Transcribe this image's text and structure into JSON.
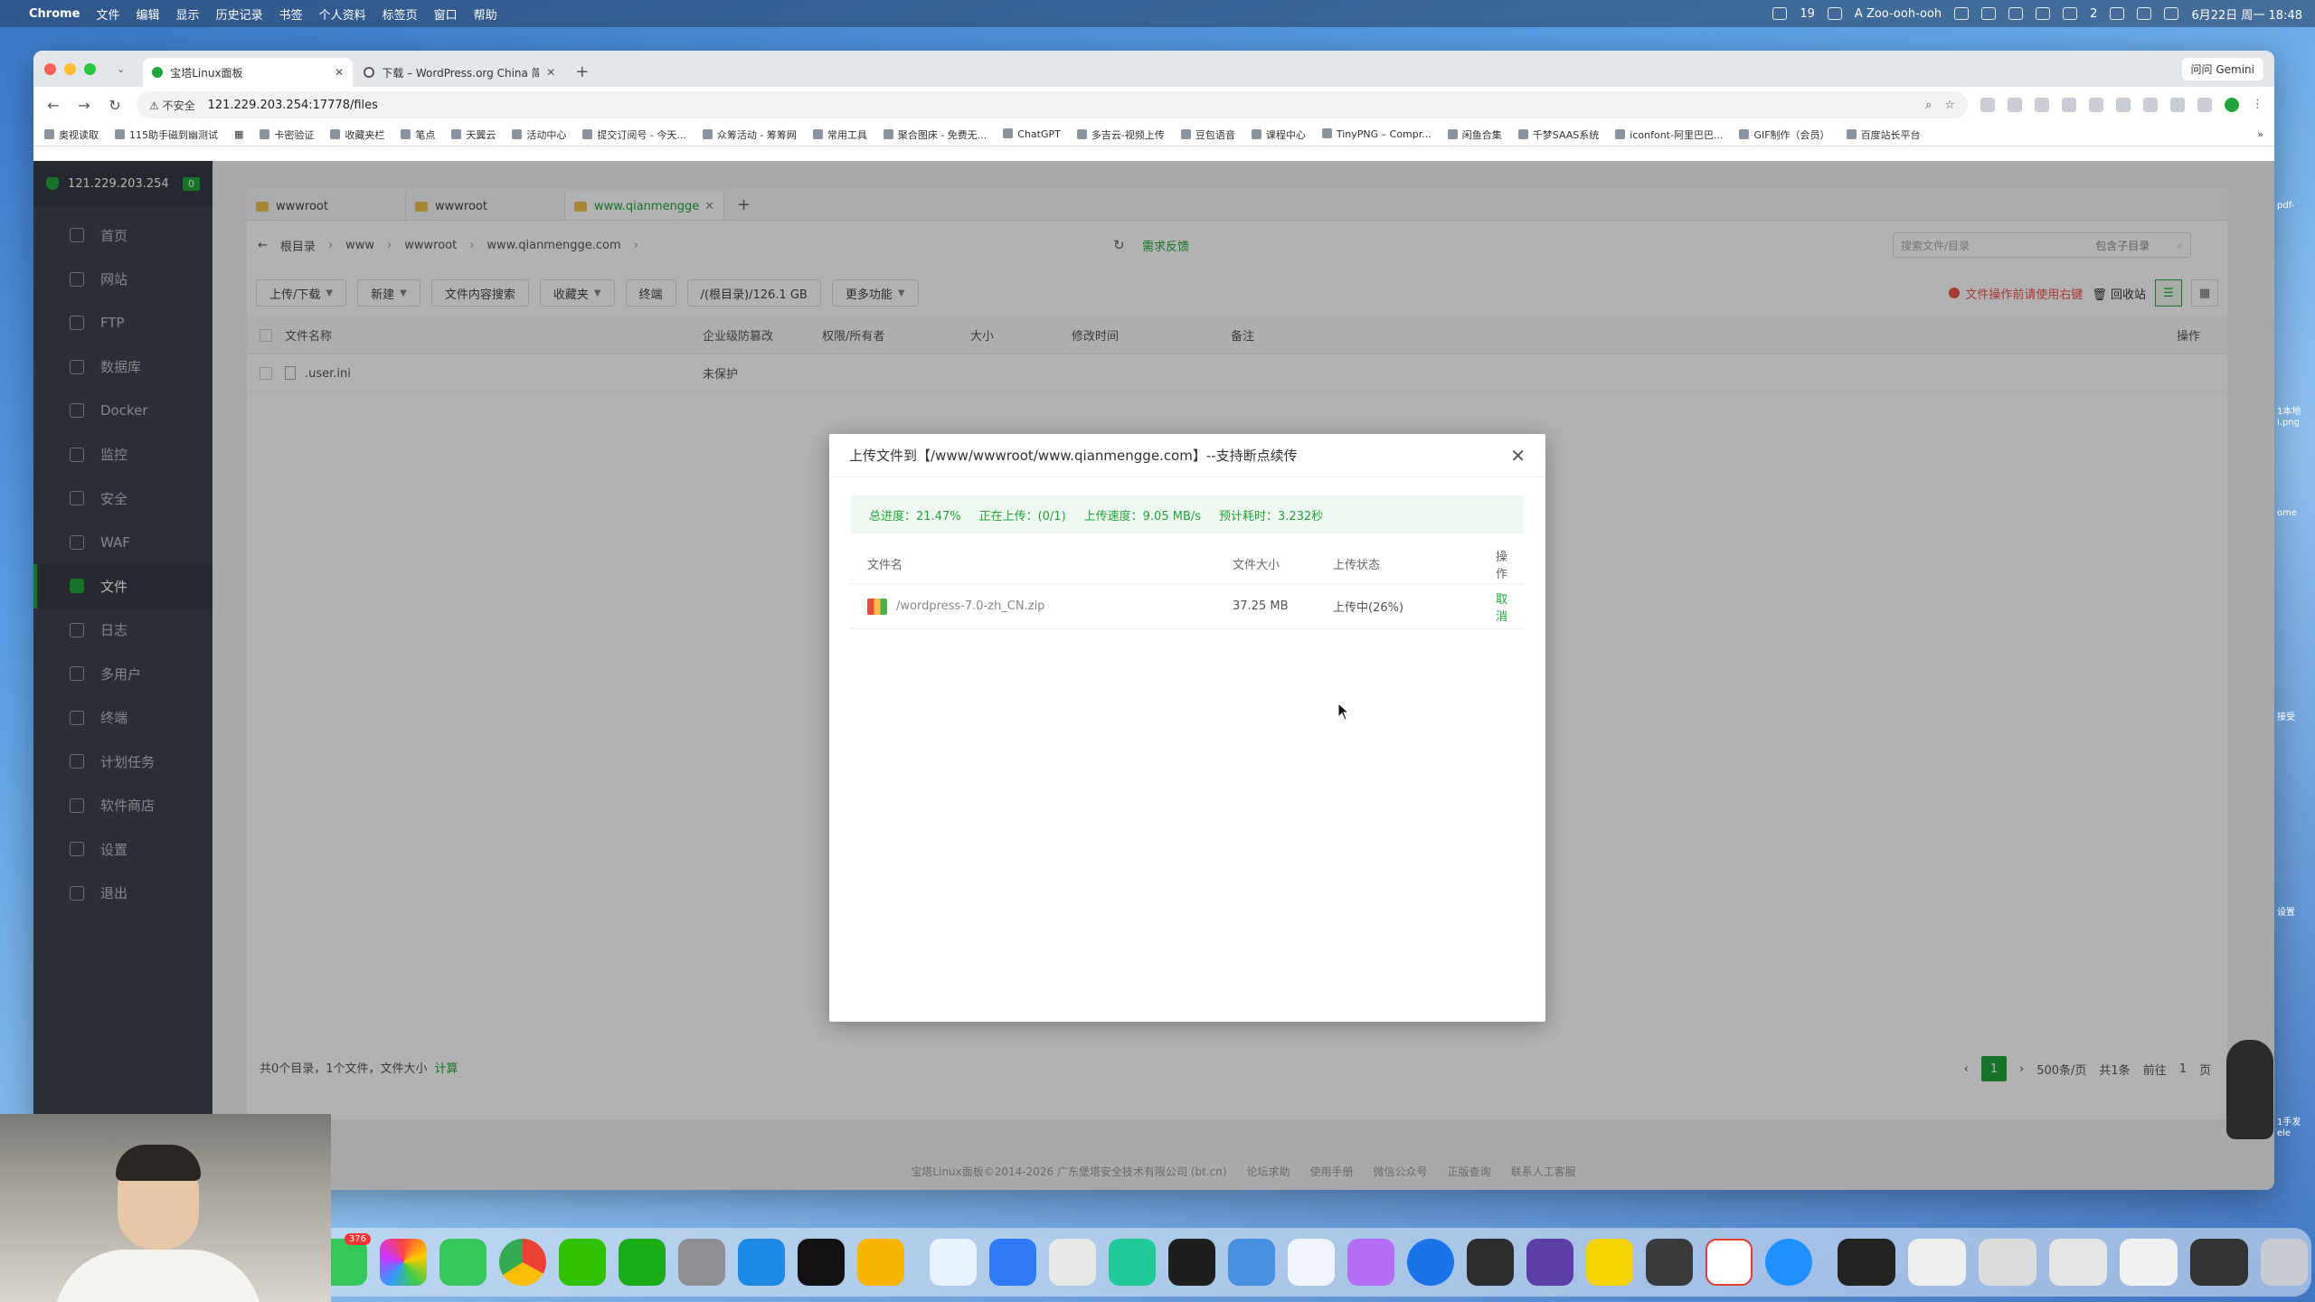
{
  "menubar": {
    "app": "Chrome",
    "items": [
      "文件",
      "编辑",
      "显示",
      "历史记录",
      "书签",
      "个人资料",
      "标签页",
      "窗口",
      "帮助"
    ],
    "user": "A Zoo-ooh-ooh",
    "calendar": "19",
    "notif_count": "2",
    "datetime": "6月22日 周一 18:48"
  },
  "browser": {
    "tabs": [
      {
        "title": "宝塔Linux面板",
        "active": true
      },
      {
        "title": "下载 – WordPress.org China 简体中文",
        "active": false
      }
    ],
    "gemini": "问问 Gemini",
    "insecure": "不安全",
    "url": "121.229.203.254:17778/files",
    "bookmarks": [
      "奥视读取",
      "115助手磁到幽测试",
      "卡密验证",
      "收藏夹栏",
      "笔点",
      "天翼云",
      "活动中心",
      "提交订阅号 - 今天...",
      "众筹活动 - 筹筹网",
      "常用工具",
      "聚合图床 - 免费无...",
      "ChatGPT",
      "多吉云-视频上传",
      "豆包语音",
      "课程中心",
      "TinyPNG – Compr...",
      "闲鱼合集",
      "千梦SAAS系统",
      "iconfont-阿里巴巴...",
      "GIF制作（会员）",
      "百度站长平台"
    ]
  },
  "sidebar": {
    "server_ip": "121.229.203.254",
    "server_badge": "0",
    "items": [
      {
        "label": "首页",
        "icon": "home-icon"
      },
      {
        "label": "网站",
        "icon": "globe-icon"
      },
      {
        "label": "FTP",
        "icon": "ftp-icon"
      },
      {
        "label": "数据库",
        "icon": "database-icon"
      },
      {
        "label": "Docker",
        "icon": "docker-icon"
      },
      {
        "label": "监控",
        "icon": "monitor-icon"
      },
      {
        "label": "安全",
        "icon": "shield-icon"
      },
      {
        "label": "WAF",
        "icon": "waf-icon"
      },
      {
        "label": "文件",
        "icon": "folder-icon",
        "active": true
      },
      {
        "label": "日志",
        "icon": "log-icon"
      },
      {
        "label": "多用户",
        "icon": "users-icon"
      },
      {
        "label": "终端",
        "icon": "terminal-icon"
      },
      {
        "label": "计划任务",
        "icon": "clock-icon"
      },
      {
        "label": "软件商店",
        "icon": "store-icon"
      },
      {
        "label": "设置",
        "icon": "gear-icon"
      },
      {
        "label": "退出",
        "icon": "logout-icon"
      }
    ]
  },
  "files": {
    "tabs": [
      "wwwroot",
      "wwwroot",
      "www.qianmengge"
    ],
    "breadcrumb": [
      "根目录",
      "www",
      "wwwroot",
      "www.qianmengge.com"
    ],
    "feedback": "需求反馈",
    "search_placeholder": "搜索文件/目录",
    "search_sub": "包含子目录",
    "actions": {
      "upload": "上传/下载",
      "new": "新建",
      "content_search": "文件内容搜索",
      "favorites": "收藏夹",
      "terminal": "终端",
      "disk": "/(根目录)/126.1 GB",
      "more": "更多功能"
    },
    "warn": "文件操作前请使用右键",
    "recycle": "回收站",
    "columns": [
      "文件名称",
      "企业级防篡改",
      "权限/所有者",
      "大小",
      "修改时间",
      "备注",
      "操作"
    ],
    "rows": [
      {
        "name": ".user.ini",
        "protect": "未保护"
      }
    ],
    "summary": "共0个目录，1个文件，文件大小",
    "calc": "计算",
    "pager": {
      "current": "1",
      "per_page": "500条/页",
      "total": "共1条",
      "goto": "前往",
      "goto_val": "1",
      "suffix": "页"
    },
    "copyright": "宝塔Linux面板©2014-2026 广东堡塔安全技术有限公司 (bt.cn)",
    "footer_links": [
      "论坛求助",
      "使用手册",
      "微信公众号",
      "正版查询",
      "联系人工客服"
    ]
  },
  "upload_dialog": {
    "title": "上传文件到【/www/wwwroot/www.qianmengge.com】--支持断点续传",
    "progress": {
      "total": "总进度：21.47%",
      "uploading": "正在上传：(0/1)",
      "speed": "上传速度：9.05 MB/s",
      "eta": "预计耗时：3.232秒"
    },
    "columns": [
      "文件名",
      "文件大小",
      "上传状态",
      "操作"
    ],
    "rows": [
      {
        "name": "/wordpress-7.0-zh_CN.zip",
        "size": "37.25 MB",
        "status": "上传中(26%)",
        "action": "取消"
      }
    ]
  },
  "dock": {
    "messages_badge": "376",
    "apps": [
      "messages",
      "photos",
      "phone",
      "chrome",
      "wechat",
      "wechat-work",
      "settings",
      "lark",
      "capcut",
      "sketch",
      "qq",
      "mail",
      "qq-music",
      "cursor",
      "terminal",
      "baidu-netdisk",
      "ticktick",
      "neko",
      "safari",
      "activity-monitor",
      "obsidian",
      "fruit",
      "ipad-app",
      "wps",
      "qq-browser"
    ]
  },
  "desktop": {
    "right_labels": [
      "pdf-",
      "1本地",
      "i.png",
      "ome",
      "接受",
      "设置",
      "1手发",
      "ele"
    ]
  }
}
